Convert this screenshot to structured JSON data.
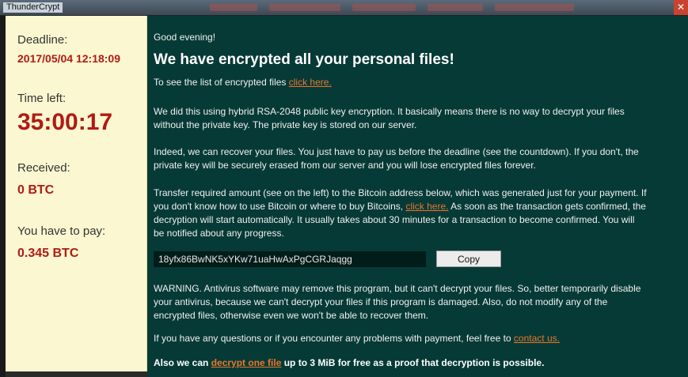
{
  "window": {
    "title": "ThunderCrypt",
    "close_glyph": "✕"
  },
  "left": {
    "deadline_label": "Deadline:",
    "deadline_value": "2017/05/04 12:18:09",
    "time_left_label": "Time left:",
    "time_left_value": "35:00:17",
    "received_label": "Received:",
    "received_value": "0 BTC",
    "pay_label": "You have to pay:",
    "pay_value": "0.345 BTC"
  },
  "main": {
    "greeting": "Good evening!",
    "headline": "We have encrypted all your personal files!",
    "list_text": "To see the list of encrypted files ",
    "list_link": "click here.",
    "para1_line1": "We did this using hybrid RSA-2048 public key encryption. It basically means there is no way to decrypt your files",
    "para1_line2": "without the private key. The private key is stored on our server.",
    "para2_line1": "Indeed, we can recover your files. You just have to pay us before the deadline (see the countdown). If you don't, the",
    "para2_line2": "private key will be securely erased from our server and you will lose encrypted files forever.",
    "para3_line1": "Transfer required amount (see on the left) to the Bitcoin address below, which was generated just for your payment. If",
    "para3_line2a": "you don't know how to use Bitcoin or where to buy Bitcoins, ",
    "para3_link": "click here.",
    "para3_line2b": " As soon as the transaction gets confirmed, the",
    "para3_line3": "decryption will start automatically. It usually takes about 30 minutes for a transaction to become confirmed. You will",
    "para3_line4": "be notified about any progress.",
    "btc_address": "18yfx86BwNK5xYKw71uaHwAxPgCGRJaqgg",
    "copy_label": "Copy",
    "warn_line1": "WARNING. Antivirus software may remove this program, but it can't decrypt your files. So, better temporarily disable",
    "warn_line2": "your antivirus, because we can't decrypt your files if this program is damaged. Also, do not modify any of the",
    "warn_line3": "encrypted files, otherwise even we won't be able to recover them.",
    "contact_text": "If you have any questions or if you encounter any problems with payment, feel free to ",
    "contact_link": "contact us.",
    "free_a": "Also we can ",
    "free_link": "decrypt one file",
    "free_b": " up to 3 MiB for free as a proof that decryption is possible."
  },
  "colors": {
    "accent_link": "#e8772b",
    "deadline_red": "#b11a13",
    "panel_bg": "#063a36",
    "left_bg": "#fbf8d1"
  }
}
